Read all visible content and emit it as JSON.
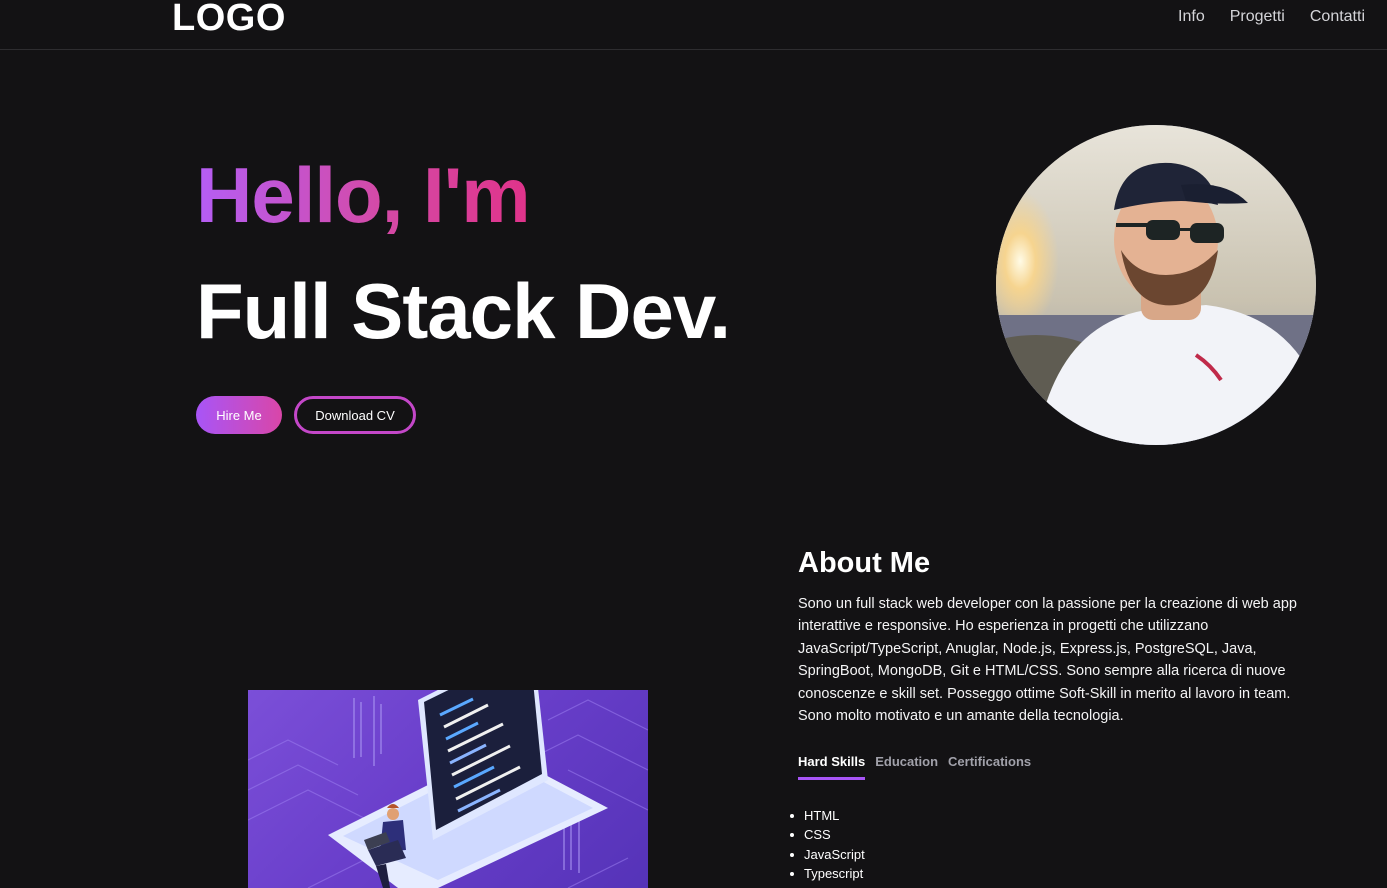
{
  "navbar": {
    "logo": "LOGO",
    "links": [
      "Info",
      "Progetti",
      "Contatti"
    ]
  },
  "hero": {
    "greeting": "Hello, I'm",
    "title": "Full Stack Dev.",
    "hire_label": "Hire Me",
    "cv_label": "Download CV"
  },
  "about": {
    "title": "About Me",
    "text": "Sono un full stack web developer con la passione per la creazione di web app interattive e responsive. Ho esperienza in progetti che utilizzano JavaScript/TypeScript, Anuglar, Node.js, Express.js, PostgreSQL, Java, SpringBoot, MongoDB, Git e HTML/CSS. Sono sempre alla ricerca di nuove conoscenze e skill set. Posseggo ottime Soft-Skill in merito al lavoro in team. Sono molto motivato e un amante della tecnologia.",
    "tabs": [
      "Hard Skills",
      "Education",
      "Certifications"
    ],
    "skills": [
      "HTML",
      "CSS",
      "JavaScript",
      "Typescript"
    ]
  },
  "colors": {
    "background": "#131214",
    "accent_purple": "#a855f7",
    "accent_pink": "#d946a8"
  }
}
